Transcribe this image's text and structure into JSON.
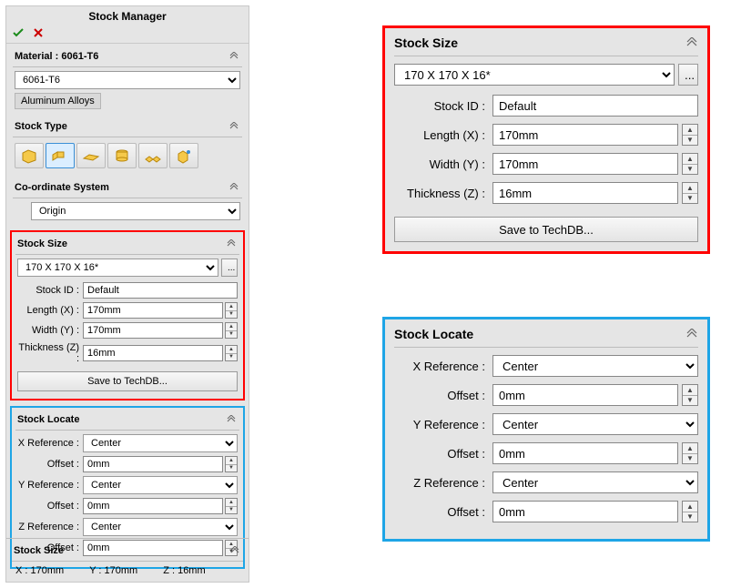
{
  "title": "Stock Manager",
  "material": {
    "heading_prefix": "Material : ",
    "name": "6061-T6",
    "dropdown_value": "6061-T6",
    "family": "Aluminum Alloys"
  },
  "stock_type": {
    "heading": "Stock Type"
  },
  "coord_system": {
    "heading": "Co-ordinate System",
    "value": "Origin"
  },
  "stock_size": {
    "heading": "Stock Size",
    "dim_string": "170 X 170 X 16*",
    "dots": "...",
    "stock_id_label": "Stock ID :",
    "stock_id": "Default",
    "length_label": "Length (X) :",
    "length": "170mm",
    "width_label": "Width (Y) :",
    "width": "170mm",
    "thickness_label": "Thickness (Z) :",
    "thickness": "16mm",
    "save_btn": "Save to TechDB..."
  },
  "stock_locate": {
    "heading": "Stock Locate",
    "xref_label": "X Reference :",
    "xref": "Center",
    "xoff_label": "Offset :",
    "xoff": "0mm",
    "yref_label": "Y Reference :",
    "yref": "Center",
    "yoff_label": "Offset :",
    "yoff": "0mm",
    "zref_label": "Z Reference :",
    "zref": "Center",
    "zoff_label": "Offset :",
    "zoff": "0mm"
  },
  "footer": {
    "heading": "Stock Size",
    "x": "X : 170mm",
    "y": "Y : 170mm",
    "z": "Z : 16mm"
  }
}
